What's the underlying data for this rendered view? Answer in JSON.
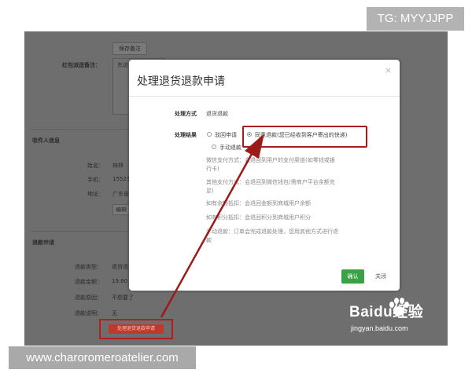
{
  "watermark_top": "TG: MYYJJPP",
  "watermark_bottom": "www.charoromeroatelier.com",
  "background": {
    "save_note_button": "保存备注",
    "red_packet_note_label": "红包派送备注：",
    "red_packet_note_value": "东达",
    "recipient_section": "收件人信息",
    "name_label": "姓名：",
    "name_value": "林林",
    "phone_label": "手机：",
    "phone_value": "15523",
    "address_label": "地址：",
    "address_value": "广东省",
    "address_button": "编辑",
    "refund_section": "退款申请",
    "refund_type_label": "退款类型：",
    "refund_type_value": "退货退",
    "refund_amount_label": "退款金额：",
    "refund_amount_value": "19.80",
    "refund_reason_label": "退款原因：",
    "refund_reason_value": "不想要了",
    "refund_desc_label": "退款说明：",
    "refund_desc_value": "无",
    "process_refund_button": "处理退货退款申请"
  },
  "modal": {
    "title": "处理退货退款申请",
    "close": "×",
    "method_label": "处理方式",
    "method_value": "退货退款",
    "result_label": "处理结果",
    "option_reject": "驳回申请",
    "option_agree": "同意退款(您已经收到客户寄出的快递)",
    "option_manual": "手动退款",
    "selected_option": "option_agree",
    "desc_wechat_1": "微信支付方式：会退回到用户的支付渠道(如零钱或银",
    "desc_wechat_2": "行卡)",
    "desc_other_1": "其他支付方式：会退回到微信钱包(需商户平台余额充",
    "desc_other_2": "足)",
    "desc_balance": "如有余额抵扣：会退回金额到商城用户余额",
    "desc_points": "如有积分抵扣：会退回积分到商城用户积分",
    "desc_manual_1": "手动退款：订单会完成退款处理，您用其他方式进行退",
    "desc_manual_2": "款",
    "confirm_label": "确认",
    "cancel_label": "关闭"
  },
  "baidu": {
    "logo_text": "Baidu经验",
    "url": "jingyan.baidu.com"
  },
  "colors": {
    "highlight_red": "#a61c1c",
    "confirm_green": "#3aa245",
    "overlay_gray": "#6e6e6e"
  },
  "icons": [
    "close-icon",
    "radio-icon",
    "arrow-annotation",
    "baidu-paw-icon"
  ]
}
